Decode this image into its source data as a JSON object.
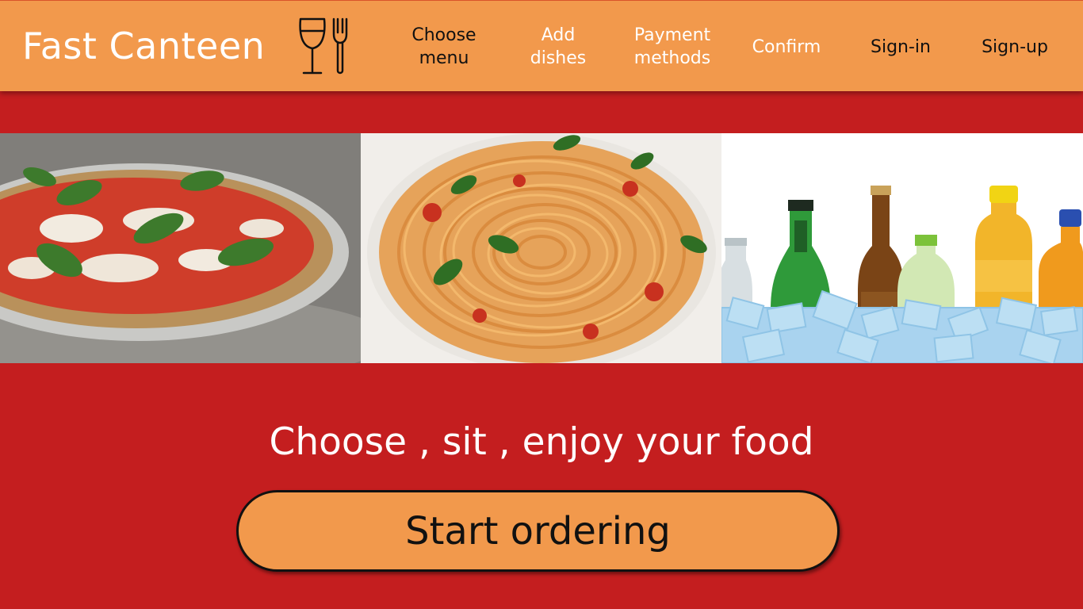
{
  "header": {
    "brand": "Fast Canteen",
    "logo_icon": "wine-glass-fork-icon",
    "background": "#f2994c",
    "nav": [
      {
        "line1": "Choose",
        "line2": "menu"
      },
      {
        "line1": "Add",
        "line2": "dishes"
      },
      {
        "line1": "Payment",
        "line2": "methods"
      },
      {
        "line1": "Confirm"
      },
      {
        "line1": "Sign-in"
      },
      {
        "line1": "Sign-up"
      }
    ]
  },
  "gallery": [
    "pizza",
    "spaghetti",
    "bottled drinks on ice"
  ],
  "hero": {
    "tagline": "Choose , sit , enjoy your food",
    "cta_label": "Start ordering"
  },
  "colors": {
    "page_background": "#c41e1f",
    "accent": "#f2994c",
    "text_light": "#ffffff",
    "text_dark": "#111111"
  }
}
